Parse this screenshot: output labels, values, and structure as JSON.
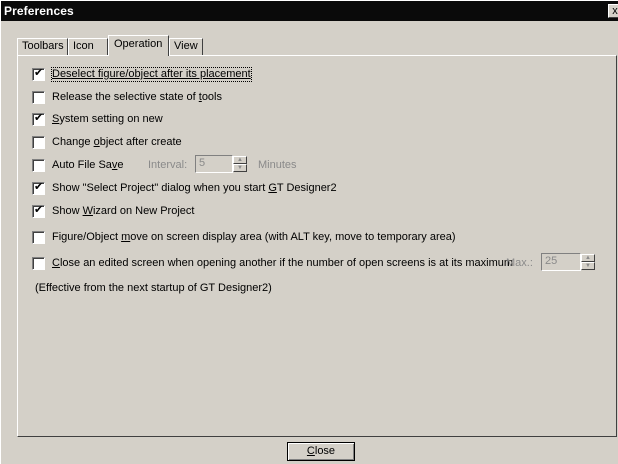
{
  "window": {
    "title": "Preferences",
    "close_glyph": "x"
  },
  "tabs": [
    {
      "label": "Toolbars",
      "active": false
    },
    {
      "label": "Icon",
      "active": false
    },
    {
      "label": "Operation",
      "active": true
    },
    {
      "label": "View",
      "active": false
    }
  ],
  "options": {
    "deselect": {
      "label": "Deselect figure/object after its placement",
      "checked": true
    },
    "release": {
      "label_pre": "Release the selective state of ",
      "label_acc": "t",
      "label_post": "ools",
      "checked": false
    },
    "system": {
      "label_acc": "S",
      "label_post": "ystem setting on new",
      "checked": true
    },
    "change": {
      "label_pre": "Change ",
      "label_acc": "o",
      "label_post": "bject after create",
      "checked": false
    },
    "autosave": {
      "label_pre": "Auto File Sa",
      "label_acc": "v",
      "label_post": "e",
      "checked": false,
      "interval_label": "Interval:",
      "interval_value": "5",
      "unit": "Minutes"
    },
    "select_project": {
      "label_pre": "Show \"Select Project\" dialog when you start ",
      "label_acc": "G",
      "label_post": "T Designer2",
      "checked": true
    },
    "wizard": {
      "label_pre": "Show ",
      "label_acc": "W",
      "label_post": "izard on New Project",
      "checked": true
    },
    "figure_move": {
      "label_pre": "Figure/Object ",
      "label_acc": "m",
      "label_post": "ove on screen display area (with ALT key, move to temporary area)",
      "checked": false
    },
    "close_screen": {
      "label_acc": "C",
      "label_post": "lose an edited screen when opening another if the number of open screens is at its maximum",
      "checked": false,
      "max_label": "Max.:",
      "max_value": "25"
    }
  },
  "note": "(Effective from the next startup of GT Designer2)",
  "buttons": {
    "close_acc": "C",
    "close_post": "lose"
  },
  "glyphs": {
    "check": "✔",
    "up": "▲",
    "down": "▼"
  }
}
